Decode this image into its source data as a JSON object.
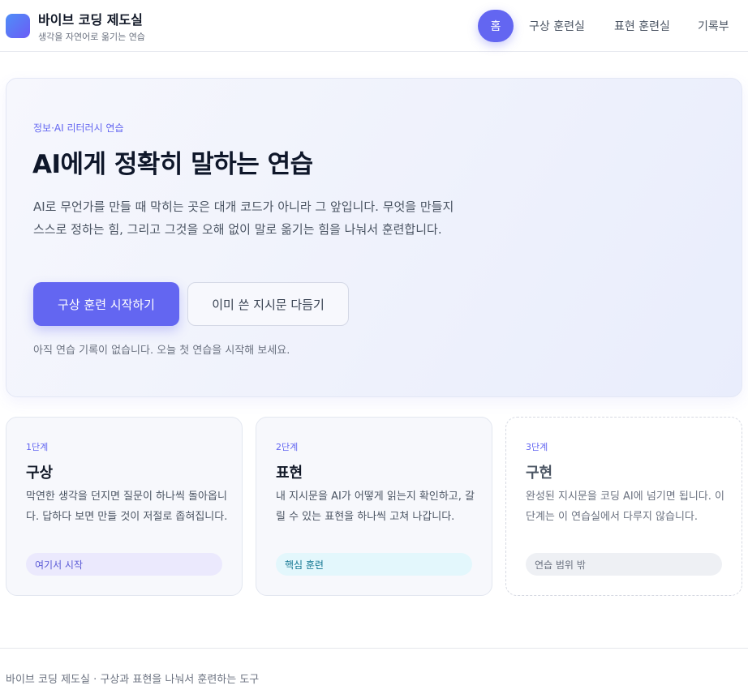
{
  "header": {
    "title": "바이브 코딩 제도실",
    "subtitle": "생각을 자연어로 옮기는 연습",
    "logo_icon": "app-logo-icon"
  },
  "nav": {
    "home": "홈",
    "items": [
      "구상 훈련실",
      "표현 훈련실",
      "기록부"
    ],
    "accent_color": "#6366f1"
  },
  "hero": {
    "eyebrow": "정보·AI 리터러시 연습",
    "title": "AI에게 정확히 말하는 연습",
    "description": "AI로 무언가를 만들 때 막히는 곳은 대개 코드가 아니라 그 앞입니다. 무엇을 만들지 스스로 정하는 힘, 그리고 그것을 오해 없이 말로 옮기는 힘을 나눠서 훈련합니다.",
    "primary_button": "구상 훈련 시작하기",
    "secondary_button": "이미 쓴 지시문 다듬기",
    "note": "아직 연습 기록이 없습니다. 오늘 첫 연습을 시작해 보세요."
  },
  "cards": [
    {
      "step": "1단계",
      "title": "구상",
      "description": "막연한 생각을 던지면 질문이 하나씩 돌아옵니다. 답하다 보면 만들 것이 저절로 좁혀집니다.",
      "badge": "여기서 시작"
    },
    {
      "step": "2단계",
      "title": "표현",
      "description": "내 지시문을 AI가 어떻게 읽는지 확인하고, 갈릴 수 있는 표현을 하나씩 고쳐 나갑니다.",
      "badge": "핵심 훈련"
    },
    {
      "step": "3단계",
      "title": "구현",
      "description": "완성된 지시문을 코딩 AI에 넘기면 됩니다. 이 단계는 이 연습실에서 다루지 않습니다.",
      "badge": "연습 범위 밖"
    }
  ],
  "footer": {
    "text": "바이브 코딩 제도실 · 구상과 표현을 나눠서 훈련하는 도구"
  }
}
